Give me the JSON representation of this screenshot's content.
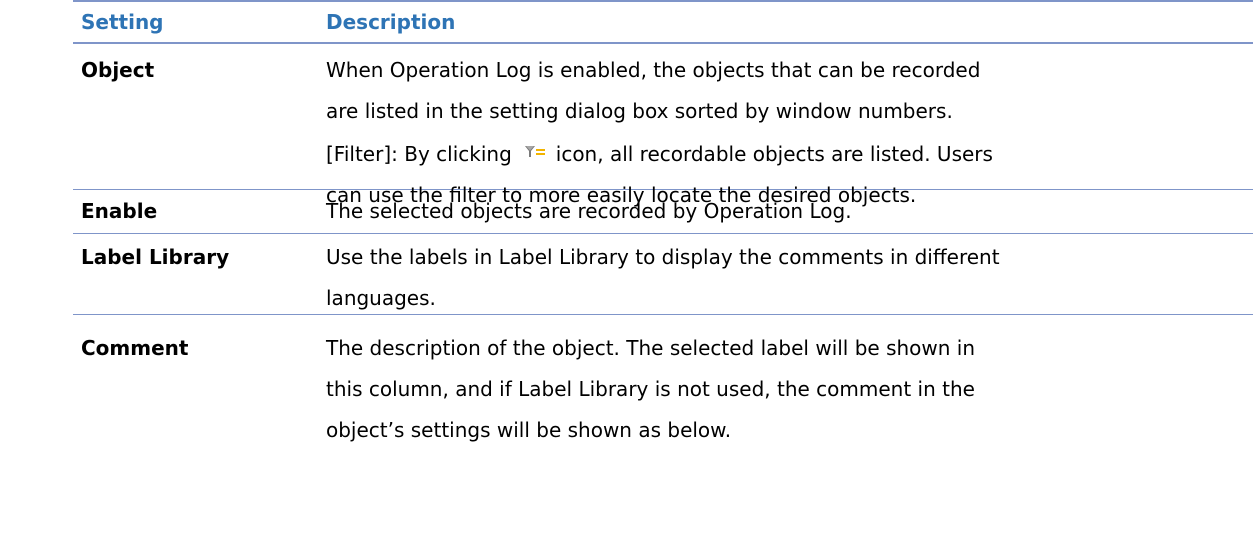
{
  "header": {
    "setting": "Setting",
    "description": "Description"
  },
  "rows": [
    {
      "setting": "Object",
      "lines": [
        "When Operation Log is enabled, the objects that can be recorded",
        "are listed in the setting dialog box sorted by window numbers."
      ],
      "filter": {
        "prefix": "[Filter]: By clicking",
        "icon": "filter-icon",
        "suffix": "icon, all recordable objects are listed. Users"
      },
      "trailing_line": "can use the filter to more easily locate the desired objects."
    },
    {
      "setting": "Enable",
      "lines": [
        "The selected objects are recorded by Operation Log."
      ]
    },
    {
      "setting": "Label Library",
      "lines": [
        "Use the labels in Label Library to display the comments in different",
        "languages."
      ]
    },
    {
      "setting": "Comment",
      "lines": [
        "The description of the object. The selected label will be shown in",
        "this column, and if Label Library is not used, the comment in the",
        "object’s settings will be shown as below."
      ]
    }
  ],
  "colors": {
    "header_text": "#2e74b5",
    "rule": "#7f95c9",
    "icon_funnel": "#7a7a7a",
    "icon_lines": "#f2b400"
  }
}
